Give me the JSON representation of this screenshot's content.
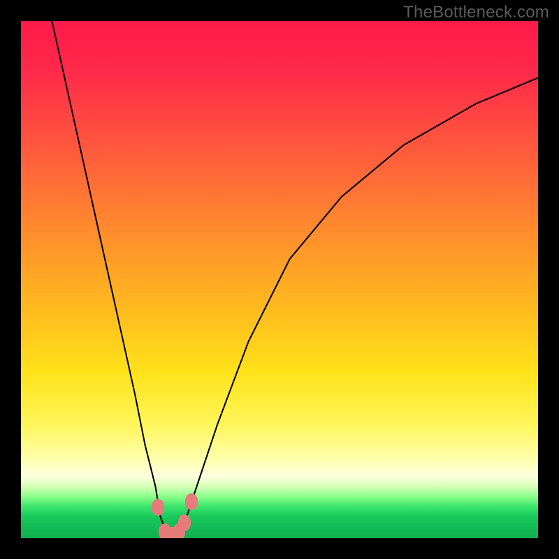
{
  "watermark": "TheBottleneck.com",
  "chart_data": {
    "type": "line",
    "title": "",
    "xlabel": "",
    "ylabel": "",
    "xlim": [
      0,
      100
    ],
    "ylim": [
      0,
      100
    ],
    "series": [
      {
        "name": "bottleneck-curve",
        "x": [
          6,
          10,
          14,
          18,
          22,
          24,
          26,
          27,
          28.5,
          30,
          32,
          34,
          38,
          44,
          52,
          62,
          74,
          88,
          100
        ],
        "values": [
          100,
          82,
          64,
          46,
          28,
          18,
          10,
          4,
          0.3,
          0.3,
          4,
          10,
          22,
          38,
          54,
          66,
          76,
          84,
          89
        ]
      }
    ],
    "markers": [
      {
        "x": 26.5,
        "y": 6
      },
      {
        "x": 27.8,
        "y": 1.2
      },
      {
        "x": 29.2,
        "y": 0.6
      },
      {
        "x": 30.6,
        "y": 1.2
      },
      {
        "x": 31.6,
        "y": 3.0
      },
      {
        "x": 33.0,
        "y": 7.0
      }
    ],
    "gradient_stops": [
      {
        "pos": 0,
        "color": "#ff1a4a"
      },
      {
        "pos": 25,
        "color": "#ff5a3d"
      },
      {
        "pos": 55,
        "color": "#ffb81f"
      },
      {
        "pos": 78,
        "color": "#fff65a"
      },
      {
        "pos": 90,
        "color": "#d8ffb8"
      },
      {
        "pos": 100,
        "color": "#0fae50"
      }
    ]
  }
}
